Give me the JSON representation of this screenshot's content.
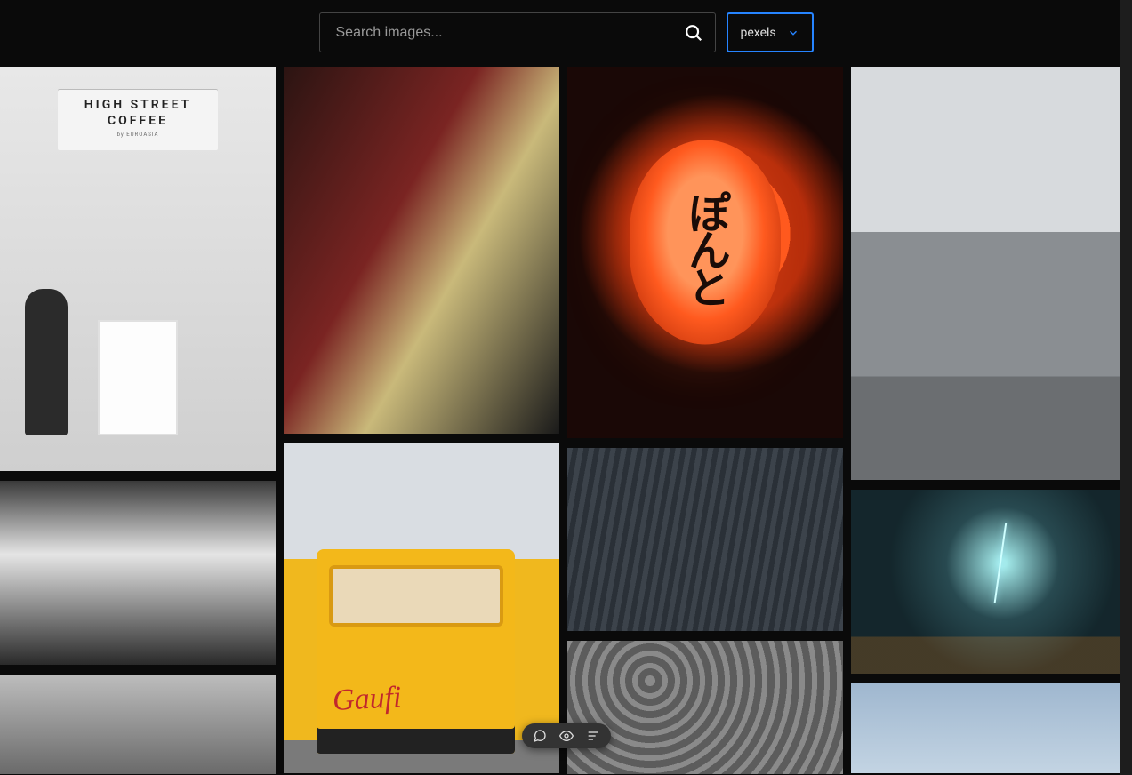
{
  "search": {
    "placeholder": "Search images...",
    "value": ""
  },
  "source_select": {
    "selected": "pexels"
  },
  "coffee_sign": {
    "line1": "HIGH STREET",
    "line2": "COFFEE",
    "sub": "by EUROASIA"
  },
  "lantern": {
    "text": "ぽんと"
  },
  "waffle_van": {
    "script": "Gaufi"
  }
}
